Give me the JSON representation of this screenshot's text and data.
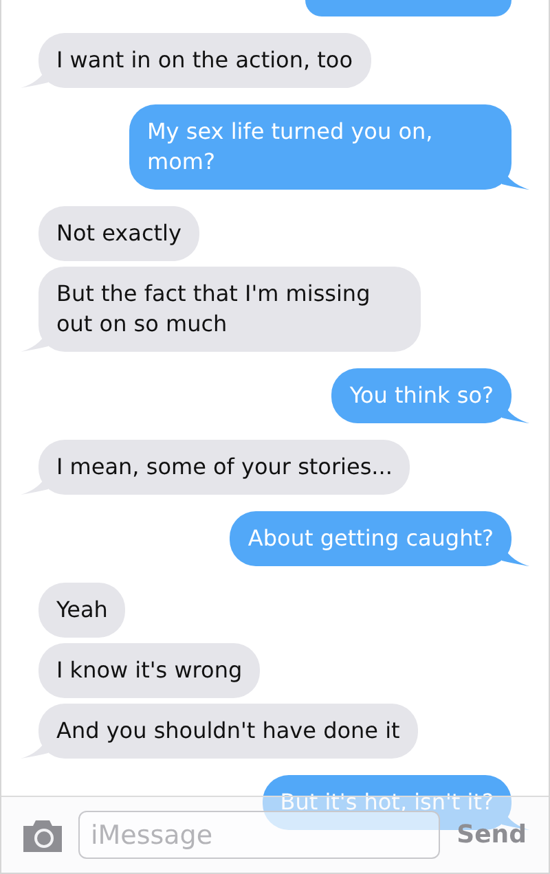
{
  "messages": [
    {
      "kind": "sent"
    },
    {
      "kind": "received",
      "text": "I want in on the action, too"
    },
    {
      "kind": "sent",
      "text": "My sex life turned you on, mom?"
    },
    {
      "kind": "received",
      "text": "Not exactly"
    },
    {
      "kind": "received",
      "text": "But the fact that I'm missing out on so much"
    },
    {
      "kind": "sent",
      "text": "You think so?"
    },
    {
      "kind": "received",
      "text": "I mean, some of your stories..."
    },
    {
      "kind": "sent",
      "text": "About getting caught?"
    },
    {
      "kind": "received",
      "text": "Yeah"
    },
    {
      "kind": "received",
      "text": "I know it's wrong"
    },
    {
      "kind": "received",
      "text": "And you shouldn't have done it"
    },
    {
      "kind": "sent",
      "text": "But it's hot, isn't it?"
    }
  ],
  "compose": {
    "placeholder": "iMessage",
    "send": "Send"
  }
}
